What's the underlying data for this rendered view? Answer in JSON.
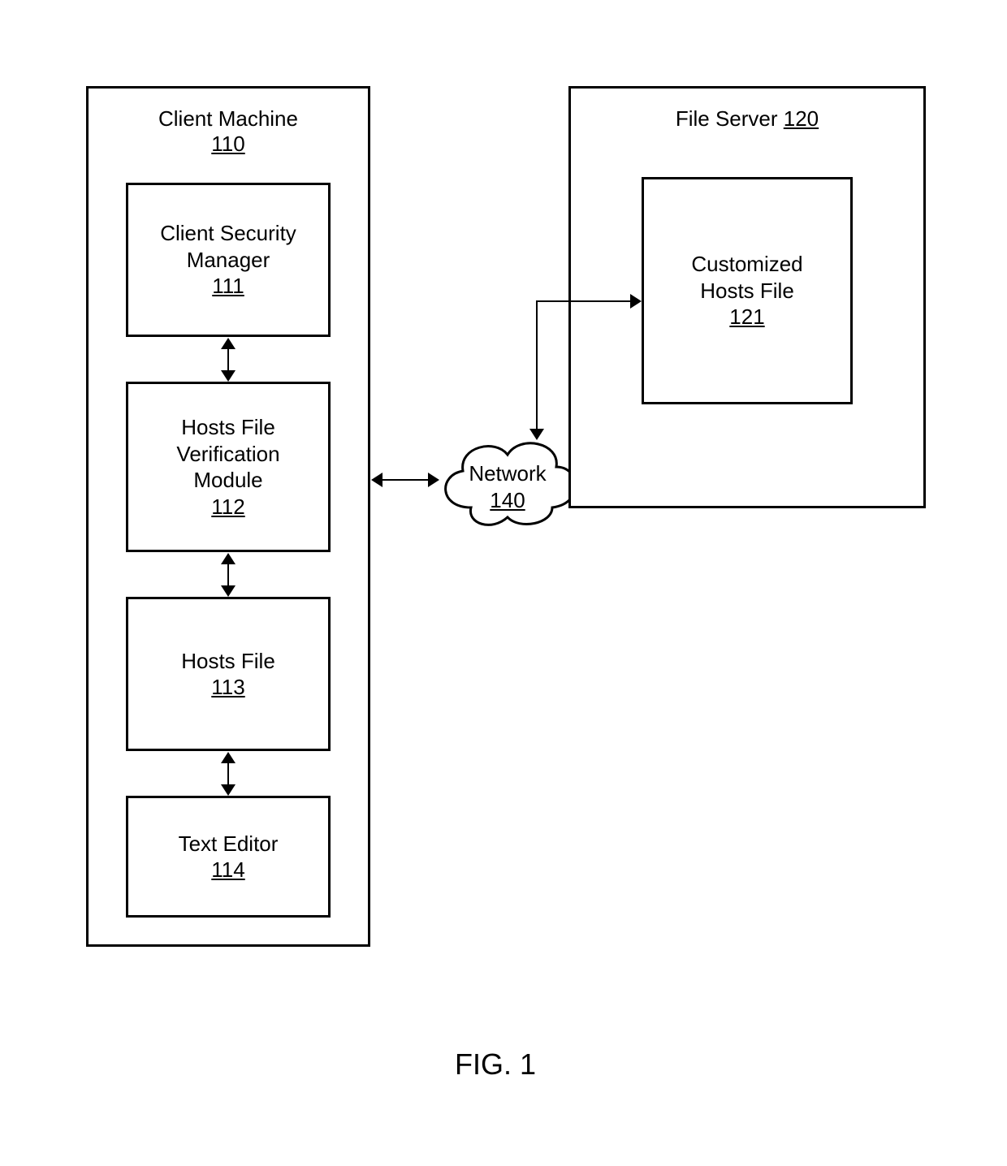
{
  "client_machine": {
    "title": "Client Machine",
    "ref": "110"
  },
  "client_security_manager": {
    "title": "Client Security\nManager",
    "ref": "111"
  },
  "hosts_file_verification": {
    "title": "Hosts File\nVerification\nModule",
    "ref": "112"
  },
  "hosts_file": {
    "title": "Hosts File",
    "ref": "113"
  },
  "text_editor": {
    "title": "Text Editor",
    "ref": "114"
  },
  "network": {
    "title": "Network",
    "ref": "140"
  },
  "file_server": {
    "title": "File Server",
    "ref": "120"
  },
  "customized_hosts_file": {
    "title": "Customized\nHosts File",
    "ref": "121"
  },
  "figure_label": "FIG. 1"
}
